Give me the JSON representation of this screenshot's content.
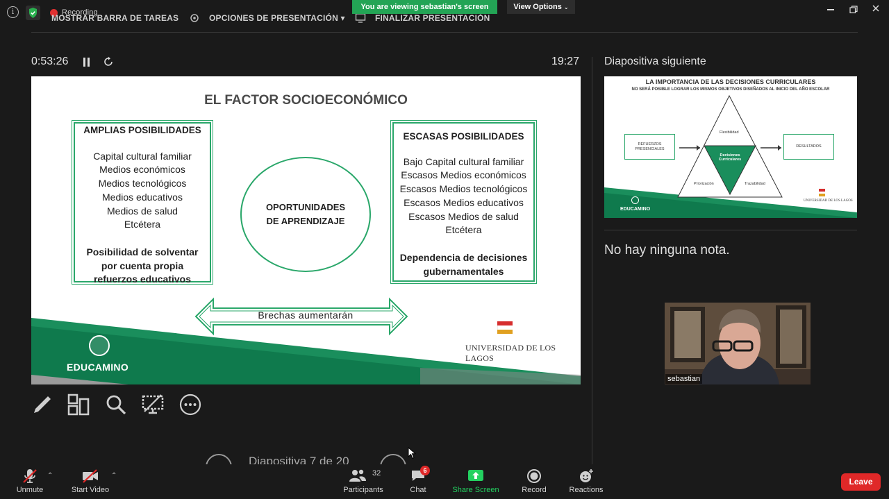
{
  "topbar": {
    "recording": "Recording",
    "show_taskbar": "MOSTRAR BARRA DE TAREAS",
    "presentation_options": "OPCIONES DE PRESENTACIÓN ▾",
    "end_presentation": "FINALIZAR PRESENTACIÓN",
    "viewing_banner": "You are viewing sebastian's screen",
    "view_options": "View Options"
  },
  "presenter": {
    "elapsed": "0:53:26",
    "clock": "19:27",
    "next_slide_label": "Diapositiva siguiente",
    "notes": "No hay ninguna nota.",
    "slide_counter": "Diapositiva 7 de 20"
  },
  "current_slide": {
    "title": "EL FACTOR SOCIOECONÓMICO",
    "left_box": {
      "head": "AMPLIAS POSIBILIDADES",
      "items": [
        "Capital cultural familiar",
        "Medios económicos",
        "Medios tecnológicos",
        "Medios educativos",
        "Medios de salud",
        "Etcétera"
      ],
      "bold_1": "Posibilidad de solventar",
      "bold_2": "por cuenta propia",
      "bold_3": "refuerzos educativos"
    },
    "circle_1": "OPORTUNIDADES",
    "circle_2": "DE APRENDIZAJE",
    "right_box": {
      "head": "ESCASAS POSIBILIDADES",
      "items": [
        "Bajo Capital cultural familiar",
        "Escasos Medios económicos",
        "Escasos Medios tecnológicos",
        "Escasos Medios educativos",
        "Escasos Medios de salud",
        "Etcétera"
      ],
      "bold_1": "Dependencia de decisiones",
      "bold_2": "gubernamentales"
    },
    "arrow_label": "Brechas aumentarán",
    "brand": "EDUCAMINO",
    "university": "UNIVERSIDAD DE LOS LAGOS"
  },
  "next_slide": {
    "title": "LA IMPORTANCIA DE LAS DECISIONES CURRICULARES",
    "subtitle": "NO SERÁ POSIBLE LOGRAR LOS MISMOS OBJETIVOS DISEÑADOS AL INICIO DEL AÑO ESCOLAR",
    "left_box": "REFUERZOS PRESENCIALES",
    "right_box": "RESULTADOS",
    "top": "Flexibilidad",
    "center": "Decisiones Curriculares",
    "left": "Priorización",
    "right": "Trazabilidad",
    "brand": "EDUCAMINO",
    "university": "UNIVERSIDAD DE LOS LAGOS"
  },
  "video": {
    "name": "sebastian"
  },
  "toolbar": {
    "unmute": "Unmute",
    "start_video": "Start Video",
    "participants": "Participants",
    "participants_count": "32",
    "chat": "Chat",
    "chat_badge": "6",
    "share_screen": "Share Screen",
    "record": "Record",
    "reactions": "Reactions",
    "leave": "Leave"
  },
  "colors": {
    "accent_green": "#2aa76a",
    "banner_green": "#23a455",
    "leave_red": "#e02828"
  }
}
